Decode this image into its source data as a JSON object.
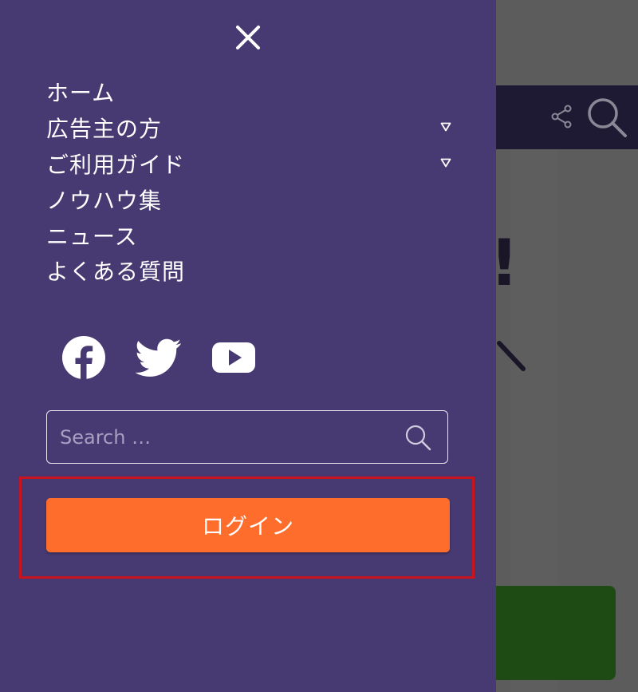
{
  "colors": {
    "drawer_bg": "#473a72",
    "login_button": "#ff6d2c",
    "highlight_border": "#c8141e",
    "overlay": "#5c5c5c"
  },
  "drawer": {
    "close_icon": "close-icon",
    "nav_items": [
      {
        "label": "ホーム",
        "has_submenu": false
      },
      {
        "label": "広告主の方",
        "has_submenu": true
      },
      {
        "label": "ご利用ガイド",
        "has_submenu": true
      },
      {
        "label": "ノウハウ集",
        "has_submenu": false
      },
      {
        "label": "ニュース",
        "has_submenu": false
      },
      {
        "label": "よくある質問",
        "has_submenu": false
      }
    ],
    "social_icons": [
      "facebook-icon",
      "twitter-icon",
      "youtube-icon"
    ],
    "search": {
      "placeholder": "Search …",
      "value": ""
    },
    "login_label": "ログイン"
  },
  "background": {
    "header_icons": [
      "share-icon",
      "search-icon"
    ],
    "visible_text": "!"
  }
}
